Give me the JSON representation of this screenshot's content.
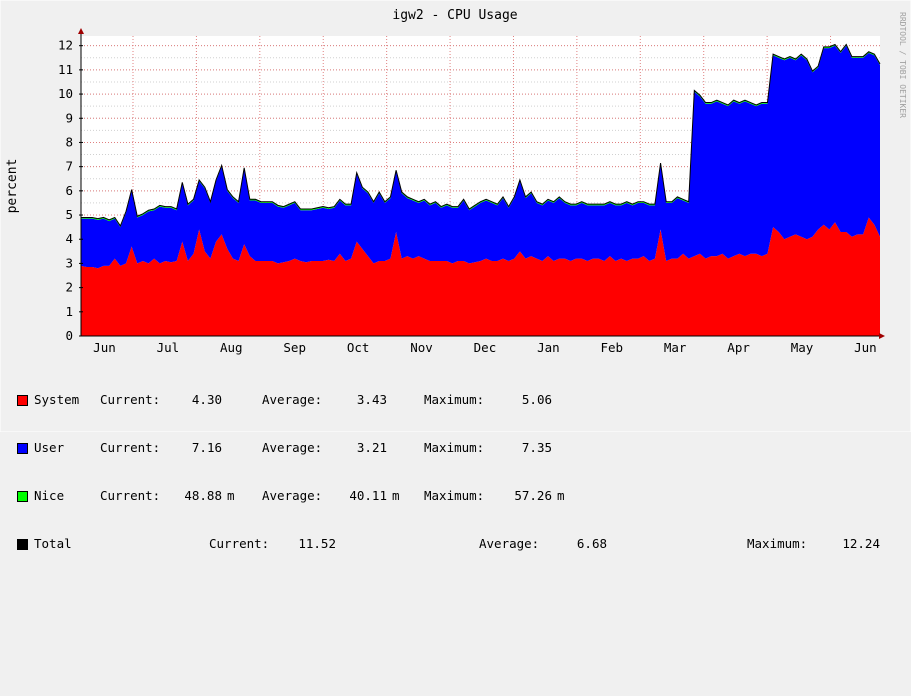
{
  "watermark": "RRDTOOL / TOBI OETIKER",
  "colors": {
    "system": "#ff0000",
    "user": "#0000ff",
    "nice": "#00ff00",
    "total": "#000000",
    "grid_major": "#e08080",
    "grid_minor": "#d0d0d0",
    "canvas": "#ffffff",
    "background": "#f0f0f0"
  },
  "chart_data": {
    "type": "area",
    "title": "igw2 - CPU Usage",
    "ylabel": "percent",
    "xlabel": "",
    "ylim": [
      0,
      12.4
    ],
    "yticks": [
      0,
      1,
      2,
      3,
      4,
      5,
      6,
      7,
      8,
      9,
      10,
      11,
      12
    ],
    "xticks": [
      "Jun",
      "Jul",
      "Aug",
      "Sep",
      "Oct",
      "Nov",
      "Dec",
      "Jan",
      "Feb",
      "Mar",
      "Apr",
      "May",
      "Jun"
    ],
    "stacked": true,
    "series": [
      {
        "name": "System",
        "color": "#ff0000",
        "values": [
          2.9,
          2.85,
          2.85,
          2.8,
          2.9,
          2.9,
          3.2,
          2.9,
          3.0,
          3.7,
          3.0,
          3.1,
          3.0,
          3.2,
          3.0,
          3.1,
          3.05,
          3.1,
          3.9,
          3.1,
          3.4,
          4.4,
          3.5,
          3.2,
          3.9,
          4.2,
          3.6,
          3.2,
          3.1,
          3.8,
          3.3,
          3.1,
          3.1,
          3.1,
          3.1,
          3.0,
          3.05,
          3.1,
          3.2,
          3.1,
          3.05,
          3.1,
          3.1,
          3.1,
          3.15,
          3.1,
          3.4,
          3.1,
          3.2,
          3.9,
          3.6,
          3.3,
          3.0,
          3.1,
          3.1,
          3.2,
          4.3,
          3.2,
          3.3,
          3.2,
          3.3,
          3.2,
          3.1,
          3.1,
          3.1,
          3.1,
          3.0,
          3.1,
          3.1,
          3.0,
          3.05,
          3.1,
          3.2,
          3.1,
          3.1,
          3.2,
          3.1,
          3.2,
          3.5,
          3.2,
          3.3,
          3.2,
          3.1,
          3.3,
          3.1,
          3.2,
          3.2,
          3.1,
          3.2,
          3.2,
          3.1,
          3.2,
          3.2,
          3.1,
          3.3,
          3.1,
          3.2,
          3.1,
          3.2,
          3.2,
          3.3,
          3.1,
          3.2,
          4.4,
          3.1,
          3.2,
          3.2,
          3.4,
          3.2,
          3.3,
          3.4,
          3.2,
          3.3,
          3.3,
          3.4,
          3.2,
          3.3,
          3.4,
          3.3,
          3.4,
          3.4,
          3.3,
          3.4,
          4.5,
          4.3,
          4.0,
          4.1,
          4.2,
          4.1,
          4.0,
          4.1,
          4.4,
          4.6,
          4.4,
          4.7,
          4.3,
          4.3,
          4.1,
          4.2,
          4.2,
          4.9,
          4.6,
          4.1
        ]
      },
      {
        "name": "User",
        "color": "#0000ff",
        "values": [
          1.95,
          2.0,
          2.0,
          2.0,
          1.95,
          1.85,
          1.65,
          1.6,
          2.1,
          2.3,
          1.9,
          1.9,
          2.15,
          2.0,
          2.35,
          2.2,
          2.25,
          2.1,
          2.4,
          2.3,
          2.2,
          2.0,
          2.6,
          2.3,
          2.5,
          2.8,
          2.4,
          2.5,
          2.4,
          3.1,
          2.3,
          2.5,
          2.4,
          2.4,
          2.4,
          2.35,
          2.25,
          2.3,
          2.3,
          2.1,
          2.15,
          2.1,
          2.15,
          2.2,
          2.1,
          2.2,
          2.2,
          2.3,
          2.2,
          2.8,
          2.5,
          2.6,
          2.5,
          2.8,
          2.4,
          2.5,
          2.5,
          2.7,
          2.4,
          2.4,
          2.2,
          2.4,
          2.3,
          2.4,
          2.2,
          2.3,
          2.3,
          2.2,
          2.5,
          2.2,
          2.3,
          2.4,
          2.4,
          2.4,
          2.3,
          2.5,
          2.2,
          2.5,
          2.9,
          2.5,
          2.6,
          2.3,
          2.3,
          2.3,
          2.4,
          2.5,
          2.3,
          2.3,
          2.2,
          2.3,
          2.3,
          2.2,
          2.2,
          2.3,
          2.2,
          2.3,
          2.2,
          2.4,
          2.2,
          2.3,
          2.2,
          2.3,
          2.2,
          2.7,
          2.4,
          2.3,
          2.5,
          2.2,
          2.3,
          6.8,
          6.5,
          6.4,
          6.3,
          6.4,
          6.2,
          6.3,
          6.4,
          6.2,
          6.4,
          6.2,
          6.1,
          6.3,
          6.2,
          7.1,
          7.2,
          7.4,
          7.4,
          7.2,
          7.5,
          7.4,
          6.8,
          6.7,
          7.3,
          7.5,
          7.3,
          7.4,
          7.7,
          7.4,
          7.3,
          7.3,
          6.8,
          7.0,
          7.1
        ]
      },
      {
        "name": "Nice",
        "color": "#00ff00",
        "values": [
          0.05,
          0.05,
          0.05,
          0.05,
          0.05,
          0.05,
          0.05,
          0.05,
          0.05,
          0.05,
          0.05,
          0.05,
          0.05,
          0.05,
          0.05,
          0.05,
          0.05,
          0.05,
          0.05,
          0.05,
          0.05,
          0.05,
          0.05,
          0.05,
          0.05,
          0.05,
          0.05,
          0.05,
          0.05,
          0.05,
          0.05,
          0.05,
          0.05,
          0.05,
          0.05,
          0.05,
          0.05,
          0.05,
          0.05,
          0.05,
          0.05,
          0.05,
          0.05,
          0.05,
          0.05,
          0.05,
          0.05,
          0.05,
          0.05,
          0.05,
          0.05,
          0.05,
          0.05,
          0.05,
          0.05,
          0.05,
          0.05,
          0.05,
          0.05,
          0.05,
          0.05,
          0.05,
          0.05,
          0.05,
          0.05,
          0.05,
          0.05,
          0.05,
          0.05,
          0.05,
          0.05,
          0.05,
          0.05,
          0.05,
          0.05,
          0.05,
          0.05,
          0.05,
          0.05,
          0.05,
          0.05,
          0.05,
          0.05,
          0.05,
          0.05,
          0.05,
          0.05,
          0.05,
          0.05,
          0.05,
          0.05,
          0.05,
          0.05,
          0.05,
          0.05,
          0.05,
          0.05,
          0.05,
          0.05,
          0.05,
          0.05,
          0.05,
          0.05,
          0.05,
          0.05,
          0.05,
          0.05,
          0.05,
          0.05,
          0.05,
          0.05,
          0.05,
          0.05,
          0.05,
          0.05,
          0.05,
          0.05,
          0.05,
          0.05,
          0.05,
          0.05,
          0.05,
          0.05,
          0.05,
          0.05,
          0.05,
          0.05,
          0.05,
          0.05,
          0.05,
          0.05,
          0.05,
          0.05,
          0.05,
          0.05,
          0.05,
          0.05,
          0.05,
          0.05,
          0.05,
          0.05,
          0.05,
          0.05
        ]
      }
    ]
  },
  "legend": [
    {
      "name": "System",
      "key": "system",
      "current_label": "Current:",
      "current": "4.30",
      "current_unit": "",
      "average_label": "Average:",
      "average": "3.43",
      "average_unit": "",
      "maximum_label": "Maximum:",
      "maximum": "5.06",
      "maximum_unit": ""
    },
    {
      "name": "User",
      "key": "user",
      "current_label": "Current:",
      "current": "7.16",
      "current_unit": "",
      "average_label": "Average:",
      "average": "3.21",
      "average_unit": "",
      "maximum_label": "Maximum:",
      "maximum": "7.35",
      "maximum_unit": ""
    },
    {
      "name": "Nice",
      "key": "nice",
      "current_label": "Current:",
      "current": "48.88",
      "current_unit": "m",
      "average_label": "Average:",
      "average": "40.11",
      "average_unit": "m",
      "maximum_label": "Maximum:",
      "maximum": "57.26",
      "maximum_unit": "m"
    }
  ],
  "total": {
    "name": "Total",
    "current_label": "Current:",
    "current": "11.52",
    "average_label": "Average:",
    "average": "6.68",
    "maximum_label": "Maximum:",
    "maximum": "12.24"
  }
}
